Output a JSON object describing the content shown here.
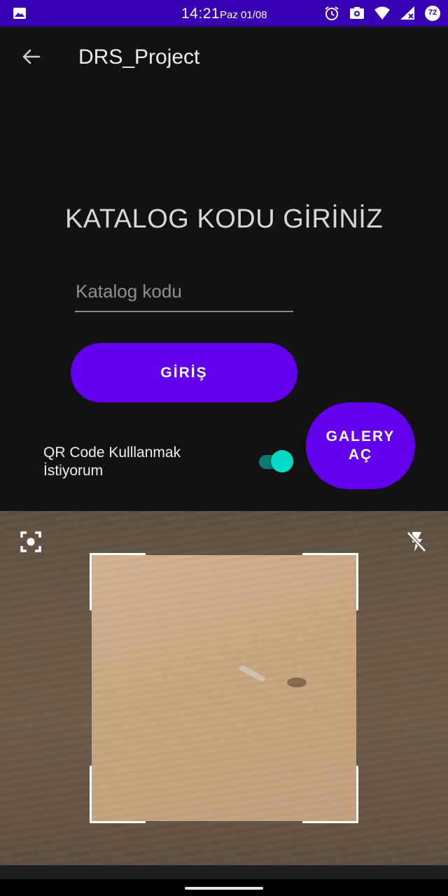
{
  "status_bar": {
    "time": "14:21",
    "date": "Paz 01/08",
    "battery": "72",
    "icons": [
      "image-icon",
      "alarm-icon",
      "screenshot-icon",
      "wifi-icon",
      "signal-icon",
      "battery-icon"
    ]
  },
  "app_bar": {
    "title": "DRS_Project",
    "back_icon": "arrow-back-icon"
  },
  "form": {
    "heading": "KATALOG KODU GİRİNİZ",
    "input_value": "",
    "input_placeholder": "Katalog kodu",
    "submit_label": "GİRİŞ",
    "switch_label": "QR Code Kulllanmak İstiyorum",
    "switch_on": true
  },
  "gallery_button": {
    "line1": "GALERY",
    "line2": "AÇ"
  },
  "camera": {
    "focus_icon": "focus-icon",
    "flash_icon": "flash-off-icon"
  },
  "colors": {
    "status_bar": "#3700b3",
    "primary": "#6200ee",
    "accent": "#03dac5",
    "background": "#121212"
  }
}
